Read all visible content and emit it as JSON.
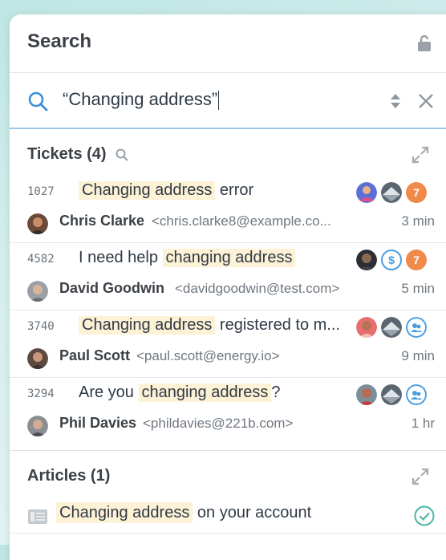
{
  "header": {
    "title": "Search"
  },
  "search": {
    "query": "“Changing address”"
  },
  "tickets": {
    "heading": "Tickets (4)",
    "items": [
      {
        "id": "1027",
        "subject_hl": "Changing address",
        "subject_rest": "error",
        "subject_pre": "",
        "customer": "Chris Clarke",
        "email": "<chris.clarke8@example.co...",
        "time": "3 min",
        "badge_type": "number",
        "badge_value": "7"
      },
      {
        "id": "4582",
        "subject_pre": "I need help",
        "subject_hl": "changing address",
        "subject_rest": "",
        "customer": "David Goodwin",
        "email": "<davidgoodwin@test.com>",
        "time": "5 min",
        "badge_type": "number",
        "badge_value": "7"
      },
      {
        "id": "3740",
        "subject_pre": "",
        "subject_hl": "Changing address",
        "subject_rest": "registered to m...",
        "customer": "Paul Scott",
        "email": "<paul.scott@energy.io>",
        "time": "9 min",
        "badge_type": "group",
        "badge_value": ""
      },
      {
        "id": "3294",
        "subject_pre": "Are you",
        "subject_hl": "changing address",
        "subject_rest": "?",
        "customer": "Phil Davies",
        "email": "<phildavies@221b.com>",
        "time": "1 hr",
        "badge_type": "group",
        "badge_value": ""
      }
    ]
  },
  "articles": {
    "heading": "Articles (1)",
    "items": [
      {
        "title_hl": "Changing address",
        "title_rest": "on your account"
      }
    ]
  },
  "colors": {
    "highlight": "#fdf1d6",
    "accent_blue": "#4a9de0",
    "badge_orange": "#f08a4b",
    "check_teal": "#4fb5a8"
  },
  "icons": [
    "lock-icon",
    "search-icon",
    "sort-icon",
    "close-icon",
    "expand-icon",
    "dollar-icon",
    "group-icon",
    "article-icon",
    "check-circle-icon"
  ]
}
